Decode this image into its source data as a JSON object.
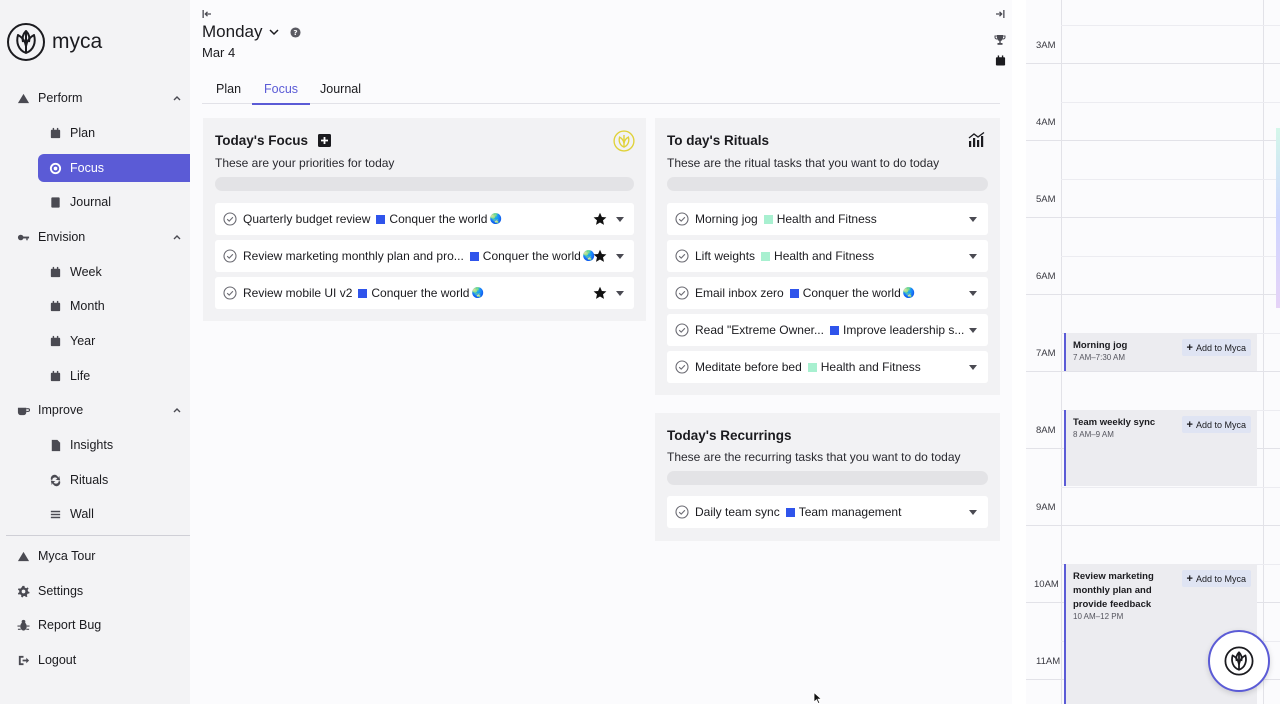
{
  "app": {
    "name": "myca"
  },
  "sidebar": {
    "groups": [
      {
        "label": "Perform",
        "icon": "mountain-icon",
        "items": [
          {
            "label": "Plan",
            "icon": "calendar-icon"
          },
          {
            "label": "Focus",
            "icon": "target-icon",
            "active": true
          },
          {
            "label": "Journal",
            "icon": "book-icon"
          }
        ]
      },
      {
        "label": "Envision",
        "icon": "key-icon",
        "items": [
          {
            "label": "Week",
            "icon": "calendar-icon"
          },
          {
            "label": "Month",
            "icon": "calendar-icon"
          },
          {
            "label": "Year",
            "icon": "calendar-icon"
          },
          {
            "label": "Life",
            "icon": "calendar-icon"
          }
        ]
      },
      {
        "label": "Improve",
        "icon": "cup-icon",
        "items": [
          {
            "label": "Insights",
            "icon": "document-icon"
          },
          {
            "label": "Rituals",
            "icon": "repeat-icon"
          },
          {
            "label": "Wall",
            "icon": "list-icon"
          }
        ]
      }
    ],
    "footer": [
      {
        "label": "Myca Tour",
        "icon": "mountain-icon"
      },
      {
        "label": "Settings",
        "icon": "gear-icon"
      },
      {
        "label": "Report Bug",
        "icon": "bug-icon"
      },
      {
        "label": "Logout",
        "icon": "logout-icon"
      }
    ]
  },
  "header": {
    "day": "Monday",
    "date": "Mar 4"
  },
  "tabs": [
    {
      "label": "Plan"
    },
    {
      "label": "Focus",
      "active": true
    },
    {
      "label": "Journal"
    }
  ],
  "focus": {
    "title": "Today's Focus",
    "subtitle": "These are your priorities for today",
    "tasks": [
      {
        "name": "Quarterly budget review",
        "goal": "Conquer the world",
        "goal_color": "#2f54eb",
        "starred": true
      },
      {
        "name": "Review marketing monthly plan and pro...",
        "goal": "Conquer the world",
        "goal_color": "#2f54eb",
        "starred": true
      },
      {
        "name": "Review mobile UI v2",
        "goal": "Conquer the world",
        "goal_color": "#2f54eb",
        "starred": true
      }
    ]
  },
  "rituals": {
    "title": "To day's Rituals",
    "subtitle": "These are the ritual tasks that you want to do today",
    "tasks": [
      {
        "name": "Morning jog",
        "goal": "Health and Fitness",
        "goal_color": "#a8f0d0",
        "globe": false
      },
      {
        "name": "Lift weights",
        "goal": "Health and Fitness",
        "goal_color": "#a8f0d0",
        "globe": false
      },
      {
        "name": "Email inbox zero",
        "goal": "Conquer the world",
        "goal_color": "#2f54eb",
        "globe": true
      },
      {
        "name": "Read \"Extreme Owner...",
        "goal": "Improve leadership s...",
        "goal_color": "#2f54eb",
        "globe": false
      },
      {
        "name": "Meditate before bed",
        "goal": "Health and Fitness",
        "goal_color": "#a8f0d0",
        "globe": false
      }
    ]
  },
  "recurrings": {
    "title": "Today's Recurrings",
    "subtitle": "These are the recurring tasks that you want to do today",
    "tasks": [
      {
        "name": "Daily team sync",
        "goal": "Team management",
        "goal_color": "#2f54eb"
      }
    ]
  },
  "calendar": {
    "hours": [
      "3AM",
      "4AM",
      "5AM",
      "6AM",
      "7AM",
      "8AM",
      "9AM",
      "10AM",
      "11AM"
    ],
    "add_label": "Add to Myca",
    "events": [
      {
        "title": "Morning jog",
        "time": "7 AM–7:30 AM",
        "start": 7,
        "end": 7.5
      },
      {
        "title": "Team weekly sync",
        "time": "8 AM–9 AM",
        "start": 8,
        "end": 9
      },
      {
        "title": "Review marketing monthly plan and provide feedback",
        "time": "10 AM–12 PM",
        "start": 10,
        "end": 12
      }
    ]
  },
  "colors": {
    "accent": "#5b5bd6",
    "goal_blue": "#2f54eb",
    "goal_green": "#a8f0d0",
    "logo_yellow": "#e0d23a"
  }
}
